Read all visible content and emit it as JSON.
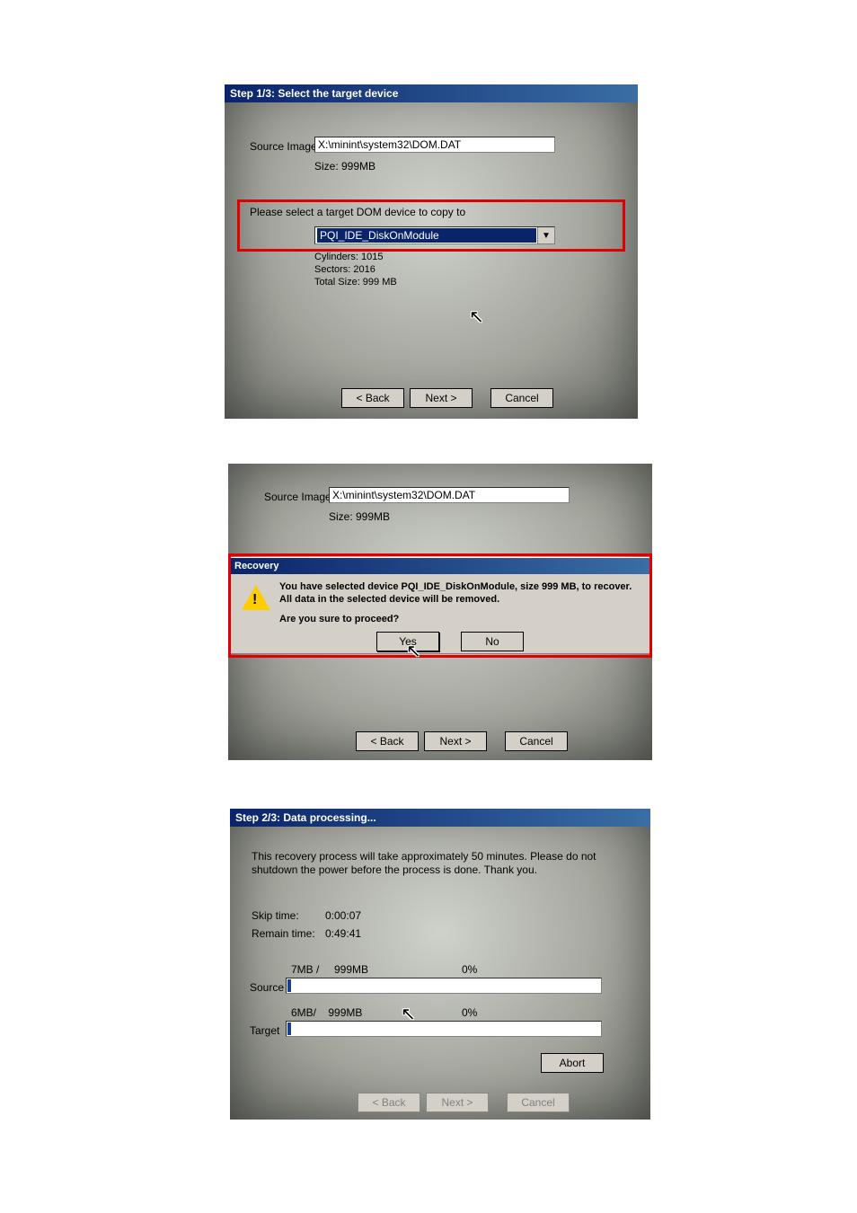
{
  "shot1": {
    "title": "Step 1/3: Select the target device",
    "source_label": "Source Image",
    "source_path": "X:\\minint\\system32\\DOM.DAT",
    "size_label": "Size: 999MB",
    "select_prompt": "Please select a target DOM device to copy to",
    "device_selected": "PQI_IDE_DiskOnModule",
    "dev_line1": "Cylinders: 1015",
    "dev_line2": "Sectors: 2016",
    "dev_line3": "Total Size: 999 MB",
    "btn_back": "< Back",
    "btn_next": "Next >",
    "btn_cancel": "Cancel"
  },
  "shot2": {
    "source_label": "Source Image",
    "source_path": "X:\\minint\\system32\\DOM.DAT",
    "size_label": "Size: 999MB",
    "dlg_title": "Recovery",
    "dlg_msg1": "You have selected device PQI_IDE_DiskOnModule, size 999 MB, to recover.",
    "dlg_msg2": "All data in the selected device will be removed.",
    "dlg_msg3": "Are you sure to proceed?",
    "btn_yes": "Yes",
    "btn_no": "No",
    "btn_back": "< Back",
    "btn_next": "Next >",
    "btn_cancel": "Cancel"
  },
  "shot3": {
    "title": "Step 2/3: Data processing...",
    "msg": "This recovery process will take approximately 50 minutes.  Please do not shutdown the power before the process is done.  Thank you.",
    "skip_label": "Skip time:",
    "skip_value": "0:00:07",
    "remain_label": "Remain time:",
    "remain_value": "0:49:41",
    "source_label": "Source",
    "source_progress_text": "7MB /     999MB",
    "source_percent": "0%",
    "target_label": "Target",
    "target_progress_text": "6MB/    999MB",
    "target_percent": "0%",
    "btn_abort": "Abort",
    "btn_back": "< Back",
    "btn_next": "Next >",
    "btn_cancel": "Cancel"
  },
  "chart_data": {
    "type": "bar",
    "title": "Recovery copy progress",
    "series": [
      {
        "name": "Source",
        "current_mb": 7,
        "total_mb": 999,
        "percent": 0
      },
      {
        "name": "Target",
        "current_mb": 6,
        "total_mb": 999,
        "percent": 0
      }
    ],
    "xlabel": "",
    "ylabel": "MB",
    "ylim": [
      0,
      999
    ]
  }
}
